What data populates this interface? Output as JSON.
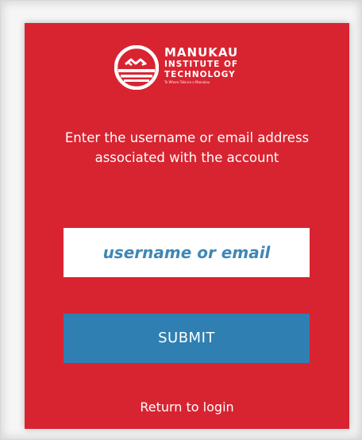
{
  "logo": {
    "name_line1": "MANUKAU",
    "name_line2": "INSTITUTE OF",
    "name_line3": "TECHNOLOGY",
    "tagline": "Te Whare Takiura o Manukau"
  },
  "form": {
    "prompt": "Enter the username or email address associated with the account",
    "username_placeholder": "username or email",
    "username_value": "",
    "submit_label": "SUBMIT",
    "return_label": "Return to login"
  },
  "colors": {
    "panel_background": "#d82431",
    "button_background": "#2f7fb2",
    "placeholder_text": "#3f87b4"
  }
}
